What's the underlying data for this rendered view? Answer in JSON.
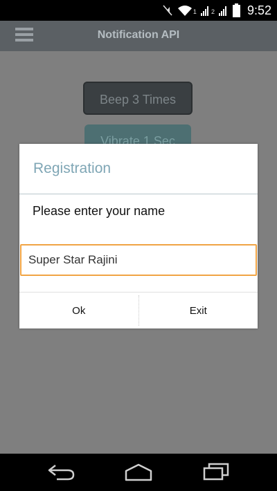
{
  "status_bar": {
    "sim1_label": "1",
    "sim2_label": "2",
    "time": "9:52",
    "icons": [
      "mute-icon",
      "wifi-icon",
      "signal-icon",
      "signal-icon",
      "battery-icon"
    ]
  },
  "action_bar": {
    "title": "Notification API",
    "menu_icon": "hamburger-menu-icon"
  },
  "background_buttons": {
    "beep_label": "Beep 3 Times",
    "vibrate_label": "Vibrate 1 Sec"
  },
  "dialog": {
    "title": "Registration",
    "message": "Please enter your name",
    "input_value": "Super Star Rajini",
    "ok_label": "Ok",
    "exit_label": "Exit"
  },
  "nav_bar": {
    "icons": [
      "back-icon",
      "home-icon",
      "recents-icon"
    ]
  },
  "colors": {
    "dim_background": "#7f7f7f",
    "action_bar": "#5b6064",
    "dialog_title": "#7fa6b5",
    "input_focus": "#f0a343"
  }
}
